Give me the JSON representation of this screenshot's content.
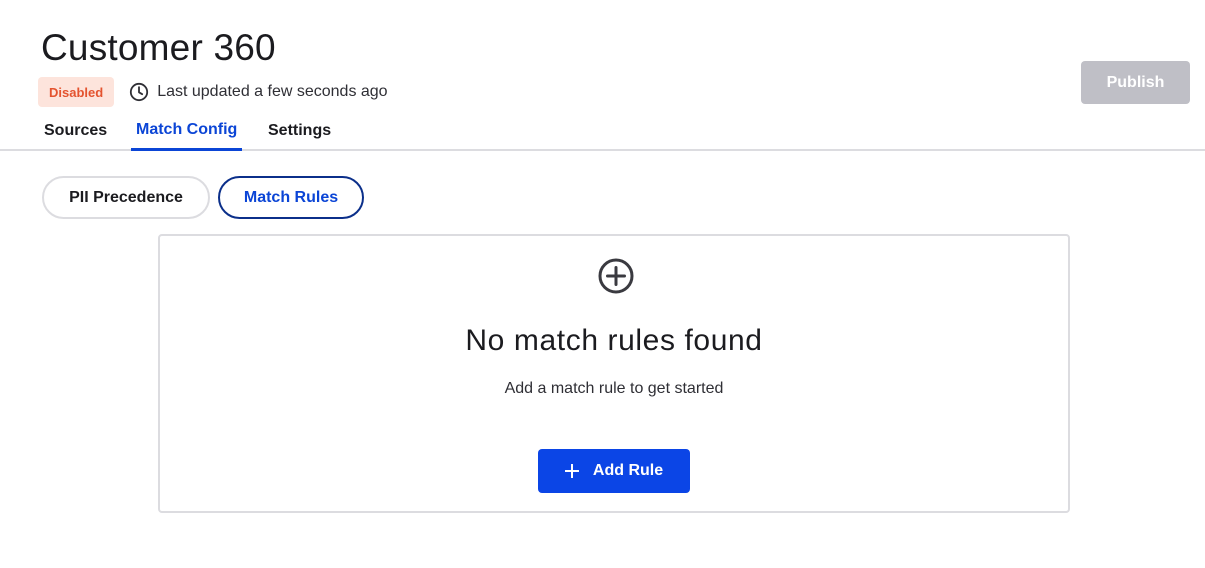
{
  "header": {
    "title": "Customer 360",
    "status_badge": "Disabled",
    "last_updated": "Last updated a few seconds ago",
    "publish_label": "Publish"
  },
  "tabs": [
    {
      "label": "Sources",
      "active": false
    },
    {
      "label": "Match Config",
      "active": true
    },
    {
      "label": "Settings",
      "active": false
    }
  ],
  "sub_tabs": [
    {
      "label": "PII Precedence",
      "active": false
    },
    {
      "label": "Match Rules",
      "active": true
    }
  ],
  "empty_state": {
    "icon": "add-circle-icon",
    "title": "No match rules found",
    "subtitle": "Add a match rule to get started",
    "button_label": "Add Rule",
    "button_icon": "plus-icon"
  },
  "colors": {
    "accent": "#0b45d6",
    "button_primary": "#0b45e6",
    "badge_bg": "#fde4dc",
    "badge_text": "#e4532f",
    "publish_disabled": "#bfbfc6"
  }
}
